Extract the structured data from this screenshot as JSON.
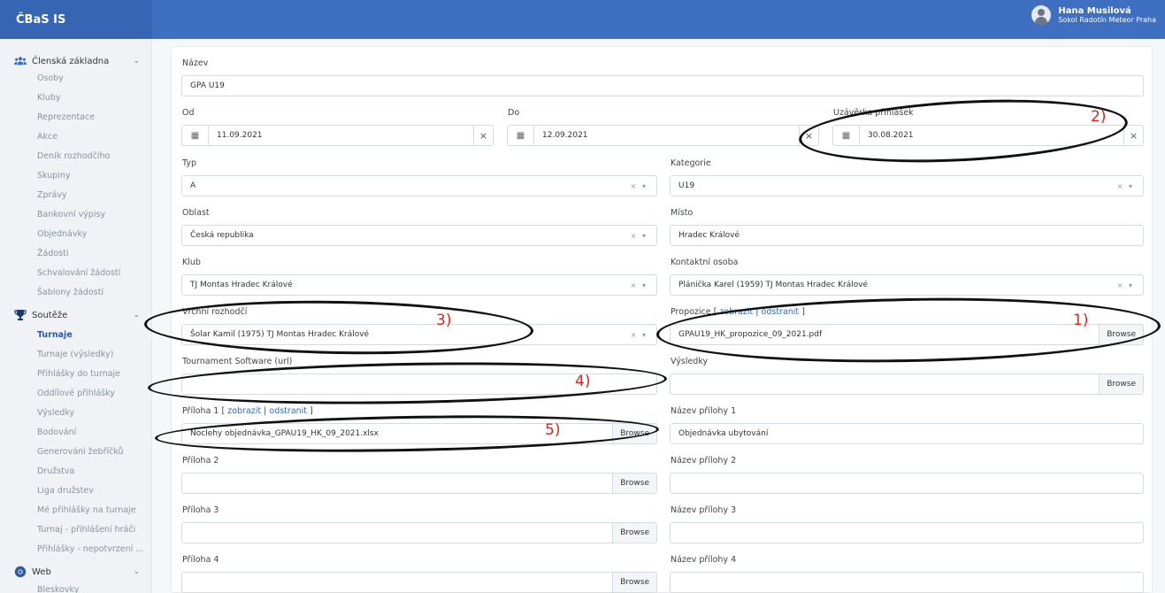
{
  "app": {
    "title": "ČBaS IS"
  },
  "user": {
    "name": "Hana Musilová",
    "club": "Sokol Radotín Meteor Praha"
  },
  "sidebar": {
    "sections": [
      {
        "label": "Členská základna",
        "icon": "users-icon"
      },
      {
        "label": "Soutěže",
        "icon": "trophy-icon"
      },
      {
        "label": "Web",
        "icon": "chrome-icon"
      }
    ],
    "members_items": [
      "Osoby",
      "Kluby",
      "Reprezentace",
      "Akce",
      "Deník rozhodčího",
      "Skupiny",
      "Zprávy",
      "Bankovní výpisy",
      "Objednávky",
      "Žádosti",
      "Schvalování žádostí",
      "Šablony žádostí"
    ],
    "competition_items": [
      "Turnaje",
      "Turnaje (výsledky)",
      "Přihlášky do turnaje",
      "Oddílové přihlášky",
      "Výsledky",
      "Bodování",
      "Generování žebříčků",
      "Družstva",
      "Liga družstev",
      "Mé přihlášky na turnaje",
      "Turnaj - přihlášení hráči",
      "Přihlášky - nepotvrzení ..."
    ],
    "web_items": [
      "Bleskovky"
    ],
    "active_item": "Turnaje"
  },
  "form": {
    "nazev": {
      "label": "Název",
      "value": "GPA U19"
    },
    "od": {
      "label": "Od",
      "value": "11.09.2021"
    },
    "do": {
      "label": "Do",
      "value": "12.09.2021"
    },
    "uzaverka": {
      "label": "Uzávěrka přihlášek",
      "value": "30.08.2021"
    },
    "typ": {
      "label": "Typ",
      "value": "A"
    },
    "kategorie": {
      "label": "Kategorie",
      "value": "U19"
    },
    "oblast": {
      "label": "Oblast",
      "value": "Česká republika"
    },
    "misto": {
      "label": "Místo",
      "value": "Hradec Králové"
    },
    "klub": {
      "label": "Klub",
      "value": "TJ Montas Hradec Králové"
    },
    "kontakt": {
      "label": "Kontaktní osoba",
      "value": "Plánička Karel (1959) TJ Montas Hradec Králové"
    },
    "rozhodci": {
      "label": "Vrchní rozhodčí",
      "value": "Šolar Kamil (1975) TJ Montas Hradec Králové"
    },
    "propozice": {
      "label": "Propozice",
      "show": "zobrazit",
      "remove": "odstranit",
      "value": "GPAU19_HK_propozice_09_2021.pdf"
    },
    "software": {
      "label": "Tournament Software (url)",
      "value": ""
    },
    "vysledky": {
      "label": "Výsledky",
      "value": ""
    },
    "priloha1": {
      "label": "Příloha 1",
      "show": "zobrazit",
      "remove": "odstranit",
      "value": "Noclehy objednávka_GPAU19_HK_09_2021.xlsx"
    },
    "nazev1": {
      "label": "Název přílohy 1",
      "value": "Objednávka ubytování"
    },
    "priloha2": {
      "label": "Příloha 2",
      "value": ""
    },
    "nazev2": {
      "label": "Název přílohy 2",
      "value": ""
    },
    "priloha3": {
      "label": "Příloha 3",
      "value": ""
    },
    "nazev3": {
      "label": "Název přílohy 3",
      "value": ""
    },
    "priloha4": {
      "label": "Příloha 4",
      "value": ""
    },
    "nazev4": {
      "label": "Název přílohy 4",
      "value": ""
    }
  },
  "controls": {
    "browse": "Browse",
    "clear": "×",
    "select_tools": "× ▾",
    "calendar": "▦",
    "chevron": "⌄"
  },
  "annotations": [
    "1)",
    "2)",
    "3)",
    "4)",
    "5)"
  ],
  "colors": {
    "header": "#3f6fc1",
    "brand": "#3565b3",
    "link": "#2f6ac1",
    "annotation": "#e2231a",
    "active_nav": "#2c5aa0"
  }
}
